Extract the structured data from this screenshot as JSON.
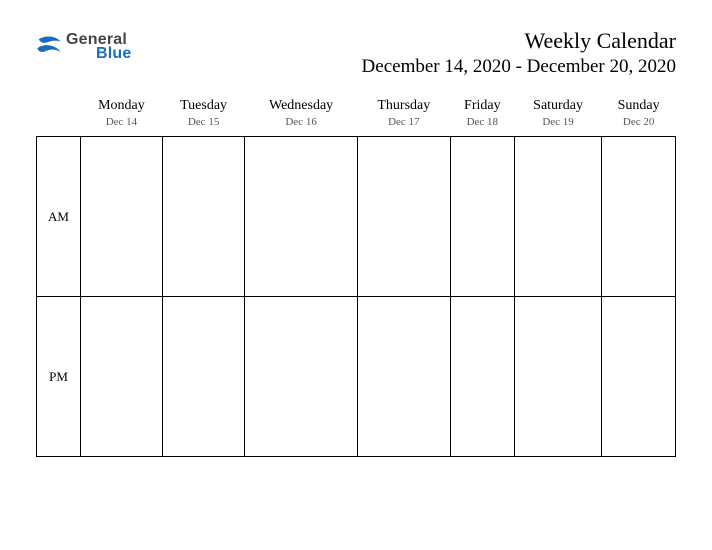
{
  "logo": {
    "word1": "General",
    "word2": "Blue"
  },
  "title": "Weekly Calendar",
  "subtitle": "December 14, 2020 - December 20, 2020",
  "rows": {
    "am": "AM",
    "pm": "PM"
  },
  "days": [
    {
      "name": "Monday",
      "date": "Dec 14"
    },
    {
      "name": "Tuesday",
      "date": "Dec 15"
    },
    {
      "name": "Wednesday",
      "date": "Dec 16"
    },
    {
      "name": "Thursday",
      "date": "Dec 17"
    },
    {
      "name": "Friday",
      "date": "Dec 18"
    },
    {
      "name": "Saturday",
      "date": "Dec 19"
    },
    {
      "name": "Sunday",
      "date": "Dec 20"
    }
  ]
}
